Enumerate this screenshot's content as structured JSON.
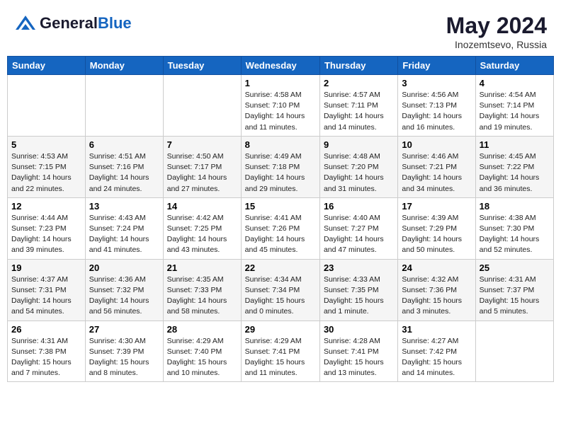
{
  "header": {
    "logo_general": "General",
    "logo_blue": "Blue",
    "month_title": "May 2024",
    "location": "Inozemtsevo, Russia"
  },
  "weekdays": [
    "Sunday",
    "Monday",
    "Tuesday",
    "Wednesday",
    "Thursday",
    "Friday",
    "Saturday"
  ],
  "weeks": [
    [
      {
        "day": "",
        "info": ""
      },
      {
        "day": "",
        "info": ""
      },
      {
        "day": "",
        "info": ""
      },
      {
        "day": "1",
        "info": "Sunrise: 4:58 AM\nSunset: 7:10 PM\nDaylight: 14 hours\nand 11 minutes."
      },
      {
        "day": "2",
        "info": "Sunrise: 4:57 AM\nSunset: 7:11 PM\nDaylight: 14 hours\nand 14 minutes."
      },
      {
        "day": "3",
        "info": "Sunrise: 4:56 AM\nSunset: 7:13 PM\nDaylight: 14 hours\nand 16 minutes."
      },
      {
        "day": "4",
        "info": "Sunrise: 4:54 AM\nSunset: 7:14 PM\nDaylight: 14 hours\nand 19 minutes."
      }
    ],
    [
      {
        "day": "5",
        "info": "Sunrise: 4:53 AM\nSunset: 7:15 PM\nDaylight: 14 hours\nand 22 minutes."
      },
      {
        "day": "6",
        "info": "Sunrise: 4:51 AM\nSunset: 7:16 PM\nDaylight: 14 hours\nand 24 minutes."
      },
      {
        "day": "7",
        "info": "Sunrise: 4:50 AM\nSunset: 7:17 PM\nDaylight: 14 hours\nand 27 minutes."
      },
      {
        "day": "8",
        "info": "Sunrise: 4:49 AM\nSunset: 7:18 PM\nDaylight: 14 hours\nand 29 minutes."
      },
      {
        "day": "9",
        "info": "Sunrise: 4:48 AM\nSunset: 7:20 PM\nDaylight: 14 hours\nand 31 minutes."
      },
      {
        "day": "10",
        "info": "Sunrise: 4:46 AM\nSunset: 7:21 PM\nDaylight: 14 hours\nand 34 minutes."
      },
      {
        "day": "11",
        "info": "Sunrise: 4:45 AM\nSunset: 7:22 PM\nDaylight: 14 hours\nand 36 minutes."
      }
    ],
    [
      {
        "day": "12",
        "info": "Sunrise: 4:44 AM\nSunset: 7:23 PM\nDaylight: 14 hours\nand 39 minutes."
      },
      {
        "day": "13",
        "info": "Sunrise: 4:43 AM\nSunset: 7:24 PM\nDaylight: 14 hours\nand 41 minutes."
      },
      {
        "day": "14",
        "info": "Sunrise: 4:42 AM\nSunset: 7:25 PM\nDaylight: 14 hours\nand 43 minutes."
      },
      {
        "day": "15",
        "info": "Sunrise: 4:41 AM\nSunset: 7:26 PM\nDaylight: 14 hours\nand 45 minutes."
      },
      {
        "day": "16",
        "info": "Sunrise: 4:40 AM\nSunset: 7:27 PM\nDaylight: 14 hours\nand 47 minutes."
      },
      {
        "day": "17",
        "info": "Sunrise: 4:39 AM\nSunset: 7:29 PM\nDaylight: 14 hours\nand 50 minutes."
      },
      {
        "day": "18",
        "info": "Sunrise: 4:38 AM\nSunset: 7:30 PM\nDaylight: 14 hours\nand 52 minutes."
      }
    ],
    [
      {
        "day": "19",
        "info": "Sunrise: 4:37 AM\nSunset: 7:31 PM\nDaylight: 14 hours\nand 54 minutes."
      },
      {
        "day": "20",
        "info": "Sunrise: 4:36 AM\nSunset: 7:32 PM\nDaylight: 14 hours\nand 56 minutes."
      },
      {
        "day": "21",
        "info": "Sunrise: 4:35 AM\nSunset: 7:33 PM\nDaylight: 14 hours\nand 58 minutes."
      },
      {
        "day": "22",
        "info": "Sunrise: 4:34 AM\nSunset: 7:34 PM\nDaylight: 15 hours\nand 0 minutes."
      },
      {
        "day": "23",
        "info": "Sunrise: 4:33 AM\nSunset: 7:35 PM\nDaylight: 15 hours\nand 1 minute."
      },
      {
        "day": "24",
        "info": "Sunrise: 4:32 AM\nSunset: 7:36 PM\nDaylight: 15 hours\nand 3 minutes."
      },
      {
        "day": "25",
        "info": "Sunrise: 4:31 AM\nSunset: 7:37 PM\nDaylight: 15 hours\nand 5 minutes."
      }
    ],
    [
      {
        "day": "26",
        "info": "Sunrise: 4:31 AM\nSunset: 7:38 PM\nDaylight: 15 hours\nand 7 minutes."
      },
      {
        "day": "27",
        "info": "Sunrise: 4:30 AM\nSunset: 7:39 PM\nDaylight: 15 hours\nand 8 minutes."
      },
      {
        "day": "28",
        "info": "Sunrise: 4:29 AM\nSunset: 7:40 PM\nDaylight: 15 hours\nand 10 minutes."
      },
      {
        "day": "29",
        "info": "Sunrise: 4:29 AM\nSunset: 7:41 PM\nDaylight: 15 hours\nand 11 minutes."
      },
      {
        "day": "30",
        "info": "Sunrise: 4:28 AM\nSunset: 7:41 PM\nDaylight: 15 hours\nand 13 minutes."
      },
      {
        "day": "31",
        "info": "Sunrise: 4:27 AM\nSunset: 7:42 PM\nDaylight: 15 hours\nand 14 minutes."
      },
      {
        "day": "",
        "info": ""
      }
    ]
  ]
}
